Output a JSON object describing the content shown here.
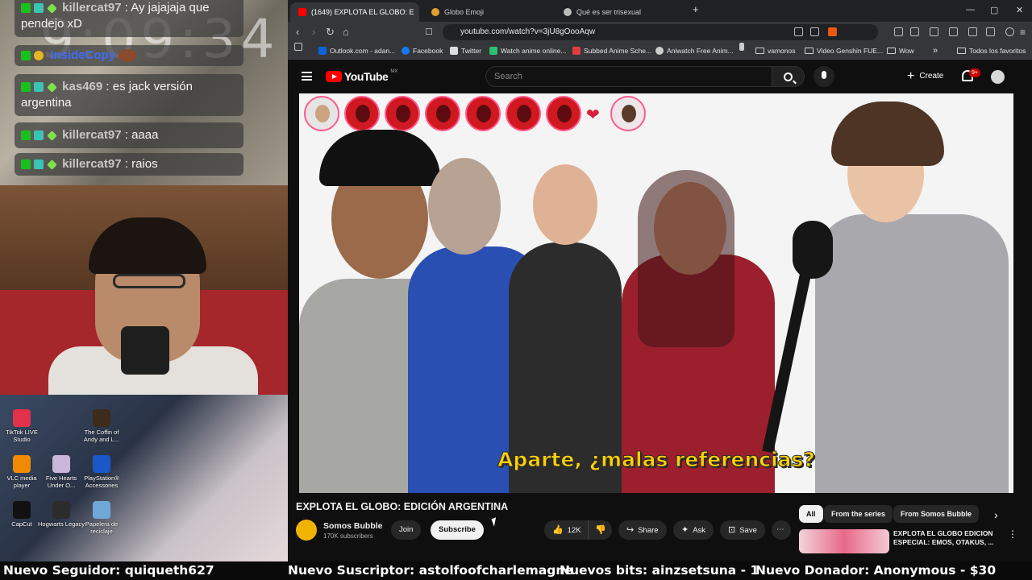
{
  "overlay": {
    "clock": "9:09:34",
    "chat": [
      {
        "user": "killercat97",
        "text": ": Ay jajajaja que pendejo xD"
      },
      {
        "user": "InsideCopy",
        "text": ""
      },
      {
        "user": "kas469",
        "text": ": es jack versión argentina"
      },
      {
        "user": "killercat97",
        "text": ": aaaa"
      },
      {
        "user": "killercat97",
        "text": ": raios"
      }
    ],
    "desktop_icons": [
      {
        "label": "TikTok LIVE Studio",
        "icon": "tiktok-icon",
        "color": "#e4314b"
      },
      {
        "label": "The Coffin of Andy and L...",
        "icon": "coffin-icon",
        "color": "#3e2b1c"
      },
      {
        "label": "VLC media player",
        "icon": "vlc-icon",
        "color": "#f08a00"
      },
      {
        "label": "Five Hearts Under O...",
        "icon": "game-icon",
        "color": "#c9b6d9"
      },
      {
        "label": "PlayStation® Accessories",
        "icon": "playstation-icon",
        "color": "#1c57c9"
      },
      {
        "label": "CapCut",
        "icon": "capcut-icon",
        "color": "#111111"
      },
      {
        "label": "Hogwarts Legacy",
        "icon": "hogwarts-icon",
        "color": "#2c2c2c"
      },
      {
        "label": "Papelera de reciclaje",
        "icon": "recycle-bin-icon",
        "color": "#6fa7d8"
      }
    ]
  },
  "browser": {
    "tabs": [
      {
        "label": "(1649) EXPLOTA EL GLOBO: E",
        "icon": "youtube-favicon",
        "color": "#ff0000",
        "active": true
      },
      {
        "label": "Globo Emoji",
        "icon": "globe-favicon",
        "color": "#e0a030",
        "active": false
      },
      {
        "label": "Qué es ser trisexual",
        "icon": "page-favicon",
        "color": "#bbbbbb",
        "active": false
      }
    ],
    "new_tab": "+",
    "window_buttons": [
      "—",
      "▢",
      "✕"
    ],
    "url": "youtube.com/watch?v=3jU8gOooAqw",
    "bookmarks": [
      {
        "label": "Outlook.com - adan...",
        "icon": "outlook-icon",
        "color": "#0a64d8"
      },
      {
        "label": "Facebook",
        "icon": "facebook-icon",
        "color": "#1877f2"
      },
      {
        "label": "Twitter",
        "icon": "x-icon",
        "color": "#dddddd"
      },
      {
        "label": "Watch anime online...",
        "icon": "anime-icon",
        "color": "#2fbf71"
      },
      {
        "label": "Subbed Anime Sche...",
        "icon": "anime-schedule-icon",
        "color": "#e23b3b"
      },
      {
        "label": "Aniwatch Free Anim...",
        "icon": "aniwatch-icon",
        "color": "#cccccc"
      },
      {
        "label": "",
        "icon": "bookmark-icon",
        "color": "#cccccc"
      },
      {
        "label": "vamonos",
        "icon": "folder-icon",
        "color": ""
      },
      {
        "label": "Video Genshin FUE...",
        "icon": "folder-icon",
        "color": ""
      },
      {
        "label": "Wow",
        "icon": "folder-icon",
        "color": ""
      }
    ],
    "bookmarks_overflow": "»",
    "all_bookmarks": "Todos los favoritos"
  },
  "youtube": {
    "logo": "YouTube",
    "region": "MX",
    "search_placeholder": "Search",
    "create": "Create",
    "notifications": "9+",
    "subtitle": "Aparte, ¿malas referencias?",
    "title": "EXPLOTA EL GLOBO: EDICIÓN ARGENTINA",
    "channel": "Somos Bubble",
    "subscribers": "170K subscribers",
    "join": "Join",
    "subscribe": "Subscribe",
    "likes": "12K",
    "share": "Share",
    "ask": "Ask",
    "save": "Save",
    "chips": [
      "All",
      "From the series",
      "From Somos Bubble"
    ],
    "rec_title": "EXPLOTA EL GLOBO EDICION ESPECIAL: EMOS, OTAKUS, ..."
  },
  "ticker": {
    "follower": "Nuevo Seguidor: quiqueth627",
    "subscriber": "Nuevo Suscriptor: astolfoofcharlemagne",
    "bits": "Nuevos bits: ainzsetsuna - 1",
    "donor": "Nuevo Donador: Anonymous - $30"
  }
}
